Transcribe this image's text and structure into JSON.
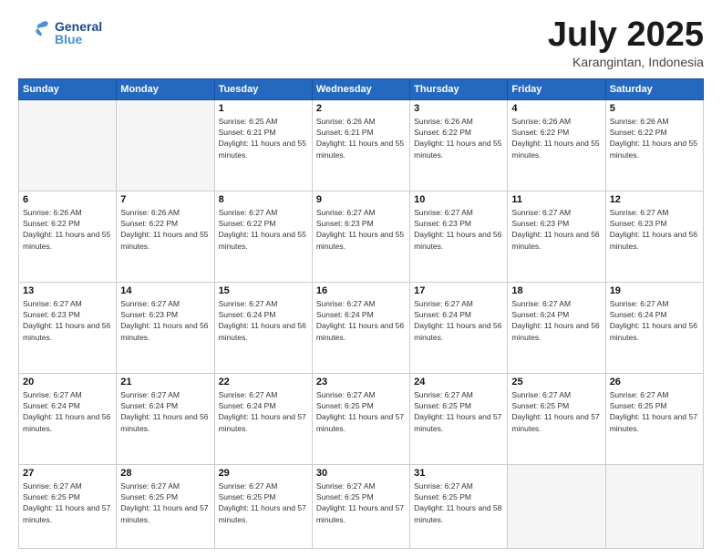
{
  "header": {
    "logo_general": "General",
    "logo_blue": "Blue",
    "month": "July 2025",
    "location": "Karangintan, Indonesia"
  },
  "days_of_week": [
    "Sunday",
    "Monday",
    "Tuesday",
    "Wednesday",
    "Thursday",
    "Friday",
    "Saturday"
  ],
  "weeks": [
    [
      {
        "day": "",
        "info": ""
      },
      {
        "day": "",
        "info": ""
      },
      {
        "day": "1",
        "info": "Sunrise: 6:25 AM\nSunset: 6:21 PM\nDaylight: 11 hours and 55 minutes."
      },
      {
        "day": "2",
        "info": "Sunrise: 6:26 AM\nSunset: 6:21 PM\nDaylight: 11 hours and 55 minutes."
      },
      {
        "day": "3",
        "info": "Sunrise: 6:26 AM\nSunset: 6:22 PM\nDaylight: 11 hours and 55 minutes."
      },
      {
        "day": "4",
        "info": "Sunrise: 6:26 AM\nSunset: 6:22 PM\nDaylight: 11 hours and 55 minutes."
      },
      {
        "day": "5",
        "info": "Sunrise: 6:26 AM\nSunset: 6:22 PM\nDaylight: 11 hours and 55 minutes."
      }
    ],
    [
      {
        "day": "6",
        "info": "Sunrise: 6:26 AM\nSunset: 6:22 PM\nDaylight: 11 hours and 55 minutes."
      },
      {
        "day": "7",
        "info": "Sunrise: 6:26 AM\nSunset: 6:22 PM\nDaylight: 11 hours and 55 minutes."
      },
      {
        "day": "8",
        "info": "Sunrise: 6:27 AM\nSunset: 6:22 PM\nDaylight: 11 hours and 55 minutes."
      },
      {
        "day": "9",
        "info": "Sunrise: 6:27 AM\nSunset: 6:23 PM\nDaylight: 11 hours and 55 minutes."
      },
      {
        "day": "10",
        "info": "Sunrise: 6:27 AM\nSunset: 6:23 PM\nDaylight: 11 hours and 56 minutes."
      },
      {
        "day": "11",
        "info": "Sunrise: 6:27 AM\nSunset: 6:23 PM\nDaylight: 11 hours and 56 minutes."
      },
      {
        "day": "12",
        "info": "Sunrise: 6:27 AM\nSunset: 6:23 PM\nDaylight: 11 hours and 56 minutes."
      }
    ],
    [
      {
        "day": "13",
        "info": "Sunrise: 6:27 AM\nSunset: 6:23 PM\nDaylight: 11 hours and 56 minutes."
      },
      {
        "day": "14",
        "info": "Sunrise: 6:27 AM\nSunset: 6:23 PM\nDaylight: 11 hours and 56 minutes."
      },
      {
        "day": "15",
        "info": "Sunrise: 6:27 AM\nSunset: 6:24 PM\nDaylight: 11 hours and 56 minutes."
      },
      {
        "day": "16",
        "info": "Sunrise: 6:27 AM\nSunset: 6:24 PM\nDaylight: 11 hours and 56 minutes."
      },
      {
        "day": "17",
        "info": "Sunrise: 6:27 AM\nSunset: 6:24 PM\nDaylight: 11 hours and 56 minutes."
      },
      {
        "day": "18",
        "info": "Sunrise: 6:27 AM\nSunset: 6:24 PM\nDaylight: 11 hours and 56 minutes."
      },
      {
        "day": "19",
        "info": "Sunrise: 6:27 AM\nSunset: 6:24 PM\nDaylight: 11 hours and 56 minutes."
      }
    ],
    [
      {
        "day": "20",
        "info": "Sunrise: 6:27 AM\nSunset: 6:24 PM\nDaylight: 11 hours and 56 minutes."
      },
      {
        "day": "21",
        "info": "Sunrise: 6:27 AM\nSunset: 6:24 PM\nDaylight: 11 hours and 56 minutes."
      },
      {
        "day": "22",
        "info": "Sunrise: 6:27 AM\nSunset: 6:24 PM\nDaylight: 11 hours and 57 minutes."
      },
      {
        "day": "23",
        "info": "Sunrise: 6:27 AM\nSunset: 6:25 PM\nDaylight: 11 hours and 57 minutes."
      },
      {
        "day": "24",
        "info": "Sunrise: 6:27 AM\nSunset: 6:25 PM\nDaylight: 11 hours and 57 minutes."
      },
      {
        "day": "25",
        "info": "Sunrise: 6:27 AM\nSunset: 6:25 PM\nDaylight: 11 hours and 57 minutes."
      },
      {
        "day": "26",
        "info": "Sunrise: 6:27 AM\nSunset: 6:25 PM\nDaylight: 11 hours and 57 minutes."
      }
    ],
    [
      {
        "day": "27",
        "info": "Sunrise: 6:27 AM\nSunset: 6:25 PM\nDaylight: 11 hours and 57 minutes."
      },
      {
        "day": "28",
        "info": "Sunrise: 6:27 AM\nSunset: 6:25 PM\nDaylight: 11 hours and 57 minutes."
      },
      {
        "day": "29",
        "info": "Sunrise: 6:27 AM\nSunset: 6:25 PM\nDaylight: 11 hours and 57 minutes."
      },
      {
        "day": "30",
        "info": "Sunrise: 6:27 AM\nSunset: 6:25 PM\nDaylight: 11 hours and 57 minutes."
      },
      {
        "day": "31",
        "info": "Sunrise: 6:27 AM\nSunset: 6:25 PM\nDaylight: 11 hours and 58 minutes."
      },
      {
        "day": "",
        "info": ""
      },
      {
        "day": "",
        "info": ""
      }
    ]
  ]
}
